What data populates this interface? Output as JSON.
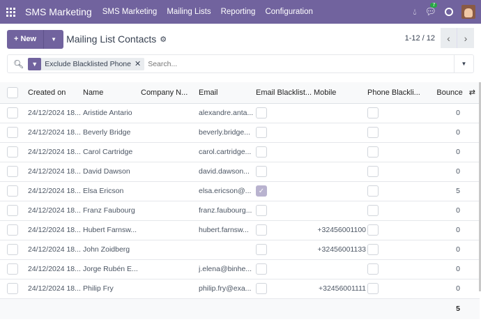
{
  "nav": {
    "app": "SMS Marketing",
    "menu": [
      "SMS Marketing",
      "Mailing Lists",
      "Reporting",
      "Configuration"
    ],
    "chat_badge": "7"
  },
  "control": {
    "new_label": "New",
    "title": "Mailing List Contacts",
    "pager": "1-12 / 12"
  },
  "search": {
    "facet": "Exclude Blacklisted Phone",
    "placeholder": "Search..."
  },
  "columns": [
    "Created on",
    "Name",
    "Company N...",
    "Email",
    "Email Blacklist...",
    "Mobile",
    "Phone Blackli...",
    "Bounce"
  ],
  "rows": [
    {
      "created": "24/12/2024 18...",
      "name": "Aristide Antario",
      "company": "",
      "email": "alexandre.anta...",
      "email_bl": false,
      "mobile": "",
      "phone_bl": false,
      "bounce": "0"
    },
    {
      "created": "24/12/2024 18...",
      "name": "Beverly Bridge",
      "company": "",
      "email": "beverly.bridge...",
      "email_bl": false,
      "mobile": "",
      "phone_bl": false,
      "bounce": "0"
    },
    {
      "created": "24/12/2024 18...",
      "name": "Carol Cartridge",
      "company": "",
      "email": "carol.cartridge...",
      "email_bl": false,
      "mobile": "",
      "phone_bl": false,
      "bounce": "0"
    },
    {
      "created": "24/12/2024 18...",
      "name": "David Dawson",
      "company": "",
      "email": "david.dawson...",
      "email_bl": false,
      "mobile": "",
      "phone_bl": false,
      "bounce": "0"
    },
    {
      "created": "24/12/2024 18...",
      "name": "Elsa Ericson",
      "company": "",
      "email": "elsa.ericson@...",
      "email_bl": true,
      "mobile": "",
      "phone_bl": false,
      "bounce": "5"
    },
    {
      "created": "24/12/2024 18...",
      "name": "Franz Faubourg",
      "company": "",
      "email": "franz.faubourg...",
      "email_bl": false,
      "mobile": "",
      "phone_bl": false,
      "bounce": "0"
    },
    {
      "created": "24/12/2024 18...",
      "name": "Hubert Farnsw...",
      "company": "",
      "email": "hubert.farnsw...",
      "email_bl": false,
      "mobile": "+32456001100",
      "phone_bl": false,
      "bounce": "0"
    },
    {
      "created": "24/12/2024 18...",
      "name": "John Zoidberg",
      "company": "",
      "email": "",
      "email_bl": false,
      "mobile": "+32456001133",
      "phone_bl": false,
      "bounce": "0"
    },
    {
      "created": "24/12/2024 18...",
      "name": "Jorge Rubén E...",
      "company": "",
      "email": "j.elena@binhe...",
      "email_bl": false,
      "mobile": "",
      "phone_bl": false,
      "bounce": "0"
    },
    {
      "created": "24/12/2024 18...",
      "name": "Philip Fry",
      "company": "",
      "email": "philip.fry@exa...",
      "email_bl": false,
      "mobile": "+32456001111",
      "phone_bl": false,
      "bounce": "0"
    }
  ],
  "footer": {
    "bounce_total": "5"
  }
}
